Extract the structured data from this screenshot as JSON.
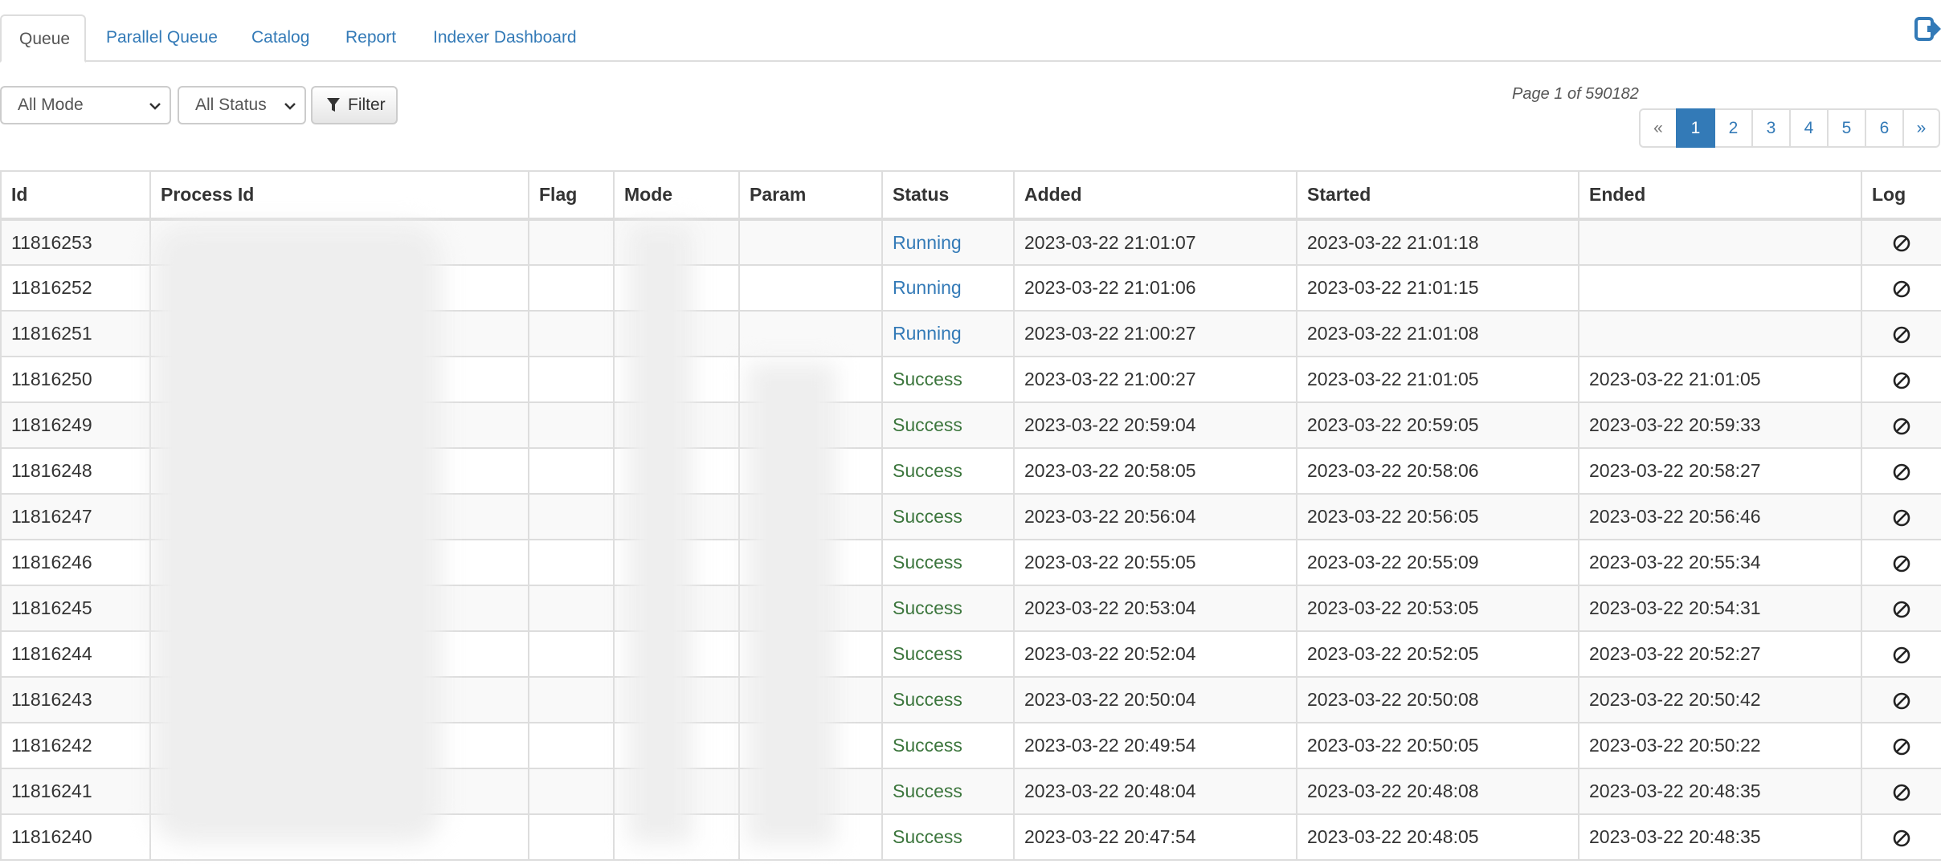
{
  "tabs": [
    {
      "label": "Queue",
      "active": true
    },
    {
      "label": "Parallel Queue",
      "active": false
    },
    {
      "label": "Catalog",
      "active": false
    },
    {
      "label": "Report",
      "active": false
    },
    {
      "label": "Indexer Dashboard",
      "active": false
    }
  ],
  "filters": {
    "mode_select": "All Mode",
    "status_select": "All Status",
    "filter_button": "Filter"
  },
  "pagination": {
    "info": "Page 1 of 590182",
    "prev": "«",
    "pages": [
      "1",
      "2",
      "3",
      "4",
      "5",
      "6"
    ],
    "current": "1",
    "next": "»"
  },
  "table": {
    "headers": [
      "Id",
      "Process Id",
      "Flag",
      "Mode",
      "Param",
      "Status",
      "Added",
      "Started",
      "Ended",
      "Log"
    ],
    "rows": [
      {
        "id": "11816253",
        "status": "Running",
        "added": "2023-03-22 21:01:07",
        "started": "2023-03-22 21:01:18",
        "ended": ""
      },
      {
        "id": "11816252",
        "status": "Running",
        "added": "2023-03-22 21:01:06",
        "started": "2023-03-22 21:01:15",
        "ended": ""
      },
      {
        "id": "11816251",
        "status": "Running",
        "added": "2023-03-22 21:00:27",
        "started": "2023-03-22 21:01:08",
        "ended": ""
      },
      {
        "id": "11816250",
        "status": "Success",
        "added": "2023-03-22 21:00:27",
        "started": "2023-03-22 21:01:05",
        "ended": "2023-03-22 21:01:05"
      },
      {
        "id": "11816249",
        "status": "Success",
        "added": "2023-03-22 20:59:04",
        "started": "2023-03-22 20:59:05",
        "ended": "2023-03-22 20:59:33"
      },
      {
        "id": "11816248",
        "status": "Success",
        "added": "2023-03-22 20:58:05",
        "started": "2023-03-22 20:58:06",
        "ended": "2023-03-22 20:58:27"
      },
      {
        "id": "11816247",
        "status": "Success",
        "added": "2023-03-22 20:56:04",
        "started": "2023-03-22 20:56:05",
        "ended": "2023-03-22 20:56:46"
      },
      {
        "id": "11816246",
        "status": "Success",
        "added": "2023-03-22 20:55:05",
        "started": "2023-03-22 20:55:09",
        "ended": "2023-03-22 20:55:34"
      },
      {
        "id": "11816245",
        "status": "Success",
        "added": "2023-03-22 20:53:04",
        "started": "2023-03-22 20:53:05",
        "ended": "2023-03-22 20:54:31"
      },
      {
        "id": "11816244",
        "status": "Success",
        "added": "2023-03-22 20:52:04",
        "started": "2023-03-22 20:52:05",
        "ended": "2023-03-22 20:52:27"
      },
      {
        "id": "11816243",
        "status": "Success",
        "added": "2023-03-22 20:50:04",
        "started": "2023-03-22 20:50:08",
        "ended": "2023-03-22 20:50:42"
      },
      {
        "id": "11816242",
        "status": "Success",
        "added": "2023-03-22 20:49:54",
        "started": "2023-03-22 20:50:05",
        "ended": "2023-03-22 20:50:22"
      },
      {
        "id": "11816241",
        "status": "Success",
        "added": "2023-03-22 20:48:04",
        "started": "2023-03-22 20:48:08",
        "ended": "2023-03-22 20:48:35"
      },
      {
        "id": "11816240",
        "status": "Success",
        "added": "2023-03-22 20:47:54",
        "started": "2023-03-22 20:48:05",
        "ended": "2023-03-22 20:48:35"
      }
    ]
  },
  "icons": {
    "logout": "logout-icon",
    "filter": "filter-icon",
    "dropdown": "chevron-down-icon",
    "log": "ban-icon"
  },
  "colors": {
    "link": "#337ab7",
    "running": "#337ab7",
    "success": "#3c763d",
    "border": "#dddddd",
    "stripe": "#f9f9f9"
  }
}
